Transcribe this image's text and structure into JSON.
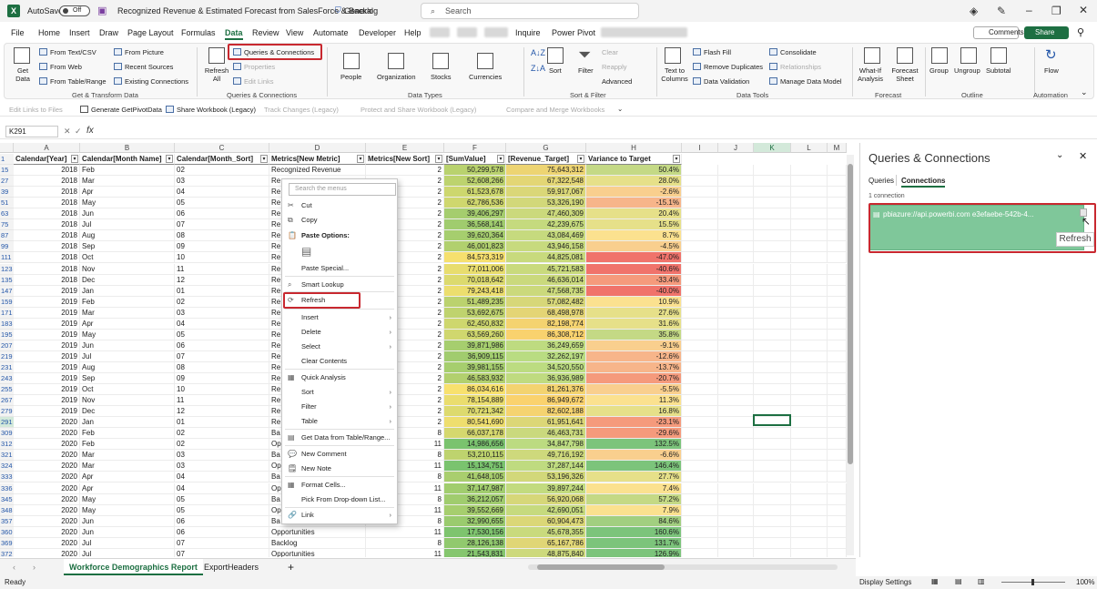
{
  "window": {
    "autosave": "AutoSave",
    "toggle": "Off",
    "title": "Recognized Revenue & Estimated Forecast from SalesForce & Backlog",
    "sensitivity": "General",
    "search_placeholder": "Search"
  },
  "menubar": {
    "items": [
      "File",
      "Home",
      "Insert",
      "Draw",
      "Page Layout",
      "Formulas",
      "Data",
      "Review",
      "View",
      "Automate",
      "Developer",
      "Help",
      "Inquire",
      "Power Pivot"
    ],
    "active": "Data",
    "comments": "Comments",
    "share": "Share"
  },
  "ribbon": {
    "get_data": "Get Data",
    "from_text": "From Text/CSV",
    "from_web": "From Web",
    "from_table": "From Table/Range",
    "from_picture": "From Picture",
    "recent_sources": "Recent Sources",
    "existing_connections": "Existing Connections",
    "grp_get": "Get & Transform Data",
    "refresh_all": "Refresh All",
    "queries_connections": "Queries & Connections",
    "properties": "Properties",
    "edit_links": "Edit Links",
    "grp_qc": "Queries & Connections",
    "data_types": [
      "People",
      "Organization",
      "Stocks",
      "Currencies"
    ],
    "grp_dt": "Data Types",
    "sort": "Sort",
    "filter": "Filter",
    "clear": "Clear",
    "reapply": "Reapply",
    "advanced": "Advanced",
    "grp_sf": "Sort & Filter",
    "text_to_columns": "Text to Columns",
    "flash_fill": "Flash Fill",
    "remove_duplicates": "Remove Duplicates",
    "data_validation": "Data Validation",
    "consolidate": "Consolidate",
    "relationships": "Relationships",
    "manage_data_model": "Manage Data Model",
    "grp_tools": "Data Tools",
    "what_if": "What-If Analysis",
    "forecast_sheet": "Forecast Sheet",
    "grp_forecast": "Forecast",
    "group": "Group",
    "ungroup": "Ungroup",
    "subtotal": "Subtotal",
    "grp_outline": "Outline",
    "flow": "Flow",
    "grp_auto": "Automation"
  },
  "quickbar": [
    "Edit Links to Files",
    "Generate GetPivotData",
    "Share Workbook (Legacy)",
    "Track Changes (Legacy)",
    "Protect and Share Workbook (Legacy)",
    "Compare and Merge Workbooks"
  ],
  "formula": {
    "namebox": "K291",
    "fx": "fx"
  },
  "columns": [
    "A",
    "B",
    "C",
    "D",
    "E",
    "F",
    "G",
    "H",
    "I",
    "J",
    "K",
    "L",
    "M"
  ],
  "headers": [
    "Calendar[Year]",
    "Calendar[Month Name]",
    "Calendar[Month_Sort]",
    "Metrics[New Metric]",
    "Metrics[New Sort]",
    "[SumValue]",
    "[Revenue_Target]",
    "Variance to Target"
  ],
  "rows": [
    [
      "15",
      "2018",
      "Feb",
      "02",
      "Recognized Revenue",
      "2",
      "50,299,578",
      "75,643,312",
      "50.4%"
    ],
    [
      "27",
      "2018",
      "Mar",
      "03",
      "Re",
      "2",
      "52,608,266",
      "67,322,548",
      "28.0%"
    ],
    [
      "39",
      "2018",
      "Apr",
      "04",
      "Re",
      "2",
      "61,523,678",
      "59,917,067",
      "-2.6%"
    ],
    [
      "51",
      "2018",
      "May",
      "05",
      "Re",
      "2",
      "62,786,536",
      "53,326,190",
      "-15.1%"
    ],
    [
      "63",
      "2018",
      "Jun",
      "06",
      "Re",
      "2",
      "39,406,297",
      "47,460,309",
      "20.4%"
    ],
    [
      "75",
      "2018",
      "Jul",
      "07",
      "Re",
      "2",
      "36,568,141",
      "42,239,675",
      "15.5%"
    ],
    [
      "87",
      "2018",
      "Aug",
      "08",
      "Re",
      "2",
      "39,620,364",
      "43,084,469",
      "8.7%"
    ],
    [
      "99",
      "2018",
      "Sep",
      "09",
      "Re",
      "2",
      "46,001,823",
      "43,946,158",
      "-4.5%"
    ],
    [
      "111",
      "2018",
      "Oct",
      "10",
      "Re",
      "2",
      "84,573,319",
      "44,825,081",
      "-47.0%"
    ],
    [
      "123",
      "2018",
      "Nov",
      "11",
      "Re",
      "2",
      "77,011,006",
      "45,721,583",
      "-40.6%"
    ],
    [
      "135",
      "2018",
      "Dec",
      "12",
      "Re",
      "2",
      "70,018,642",
      "46,636,014",
      "-33.4%"
    ],
    [
      "147",
      "2019",
      "Jan",
      "01",
      "Re",
      "2",
      "79,243,418",
      "47,568,735",
      "-40.0%"
    ],
    [
      "159",
      "2019",
      "Feb",
      "02",
      "Re",
      "2",
      "51,489,235",
      "57,082,482",
      "10.9%"
    ],
    [
      "171",
      "2019",
      "Mar",
      "03",
      "Re",
      "2",
      "53,692,675",
      "68,498,978",
      "27.6%"
    ],
    [
      "183",
      "2019",
      "Apr",
      "04",
      "Re",
      "2",
      "62,450,832",
      "82,198,774",
      "31.6%"
    ],
    [
      "195",
      "2019",
      "May",
      "05",
      "Re",
      "2",
      "63,569,260",
      "86,308,712",
      "35.8%"
    ],
    [
      "207",
      "2019",
      "Jun",
      "06",
      "Re",
      "2",
      "39,871,986",
      "36,249,659",
      "-9.1%"
    ],
    [
      "219",
      "2019",
      "Jul",
      "07",
      "Re",
      "2",
      "36,909,115",
      "32,262,197",
      "-12.6%"
    ],
    [
      "231",
      "2019",
      "Aug",
      "08",
      "Re",
      "2",
      "39,981,155",
      "34,520,550",
      "-13.7%"
    ],
    [
      "243",
      "2019",
      "Sep",
      "09",
      "Re",
      "2",
      "46,583,932",
      "36,936,989",
      "-20.7%"
    ],
    [
      "255",
      "2019",
      "Oct",
      "10",
      "Re",
      "2",
      "86,034,616",
      "81,261,376",
      "-5.5%"
    ],
    [
      "267",
      "2019",
      "Nov",
      "11",
      "Re",
      "2",
      "78,154,889",
      "86,949,672",
      "11.3%"
    ],
    [
      "279",
      "2019",
      "Dec",
      "12",
      "Re",
      "2",
      "70,721,342",
      "82,602,188",
      "16.8%"
    ],
    [
      "291",
      "2020",
      "Jan",
      "01",
      "Re",
      "2",
      "80,541,690",
      "61,951,641",
      "-23.1%"
    ],
    [
      "309",
      "2020",
      "Feb",
      "02",
      "Ba",
      "8",
      "66,037,178",
      "46,463,731",
      "-29.6%"
    ],
    [
      "312",
      "2020",
      "Feb",
      "02",
      "Op",
      "11",
      "14,986,656",
      "34,847,798",
      "132.5%"
    ],
    [
      "321",
      "2020",
      "Mar",
      "03",
      "Ba",
      "8",
      "53,210,115",
      "49,716,192",
      "-6.6%"
    ],
    [
      "324",
      "2020",
      "Mar",
      "03",
      "Op",
      "11",
      "15,134,751",
      "37,287,144",
      "146.4%"
    ],
    [
      "333",
      "2020",
      "Apr",
      "04",
      "Ba",
      "8",
      "41,648,105",
      "53,196,326",
      "27.7%"
    ],
    [
      "336",
      "2020",
      "Apr",
      "04",
      "Op",
      "11",
      "37,147,987",
      "39,897,244",
      "7.4%"
    ],
    [
      "345",
      "2020",
      "May",
      "05",
      "Ba",
      "8",
      "36,212,057",
      "56,920,068",
      "57.2%"
    ],
    [
      "348",
      "2020",
      "May",
      "05",
      "Op",
      "11",
      "39,552,669",
      "42,690,051",
      "7.9%"
    ],
    [
      "357",
      "2020",
      "Jun",
      "06",
      "Ba",
      "8",
      "32,990,655",
      "60,904,473",
      "84.6%"
    ],
    [
      "360",
      "2020",
      "Jun",
      "06",
      "Opportunities",
      "11",
      "17,530,156",
      "45,678,355",
      "160.6%"
    ],
    [
      "369",
      "2020",
      "Jul",
      "07",
      "Backlog",
      "8",
      "28,126,138",
      "65,167,786",
      "131.7%"
    ],
    [
      "372",
      "2020",
      "Jul",
      "07",
      "Opportunities",
      "11",
      "21,543,831",
      "48,875,840",
      "126.9%"
    ]
  ],
  "context_menu": {
    "search": "Search the menus",
    "items": [
      "Cut",
      "Copy",
      "Paste Options:",
      "",
      "Paste Special...",
      "Smart Lookup",
      "Refresh",
      "Insert",
      "Delete",
      "Select",
      "Clear Contents",
      "Quick Analysis",
      "Sort",
      "Filter",
      "Table",
      "Get Data from Table/Range...",
      "New Comment",
      "New Note",
      "Format Cells...",
      "Pick From Drop-down List...",
      "Link"
    ]
  },
  "pane": {
    "title": "Queries & Connections",
    "tab_queries": "Queries",
    "tab_connections": "Connections",
    "count": "1 connection",
    "connection": "pbiazure://api.powerbi.com e3efaebe-542b-4...",
    "tooltip": "Refresh"
  },
  "tabs": [
    "Workforce Demographics Report",
    "ExportHeaders"
  ],
  "status": {
    "ready": "Ready",
    "display": "Display Settings",
    "zoom": "100%"
  },
  "colors": {
    "accent": "#1d6f42",
    "highlight": "#c8282f"
  }
}
